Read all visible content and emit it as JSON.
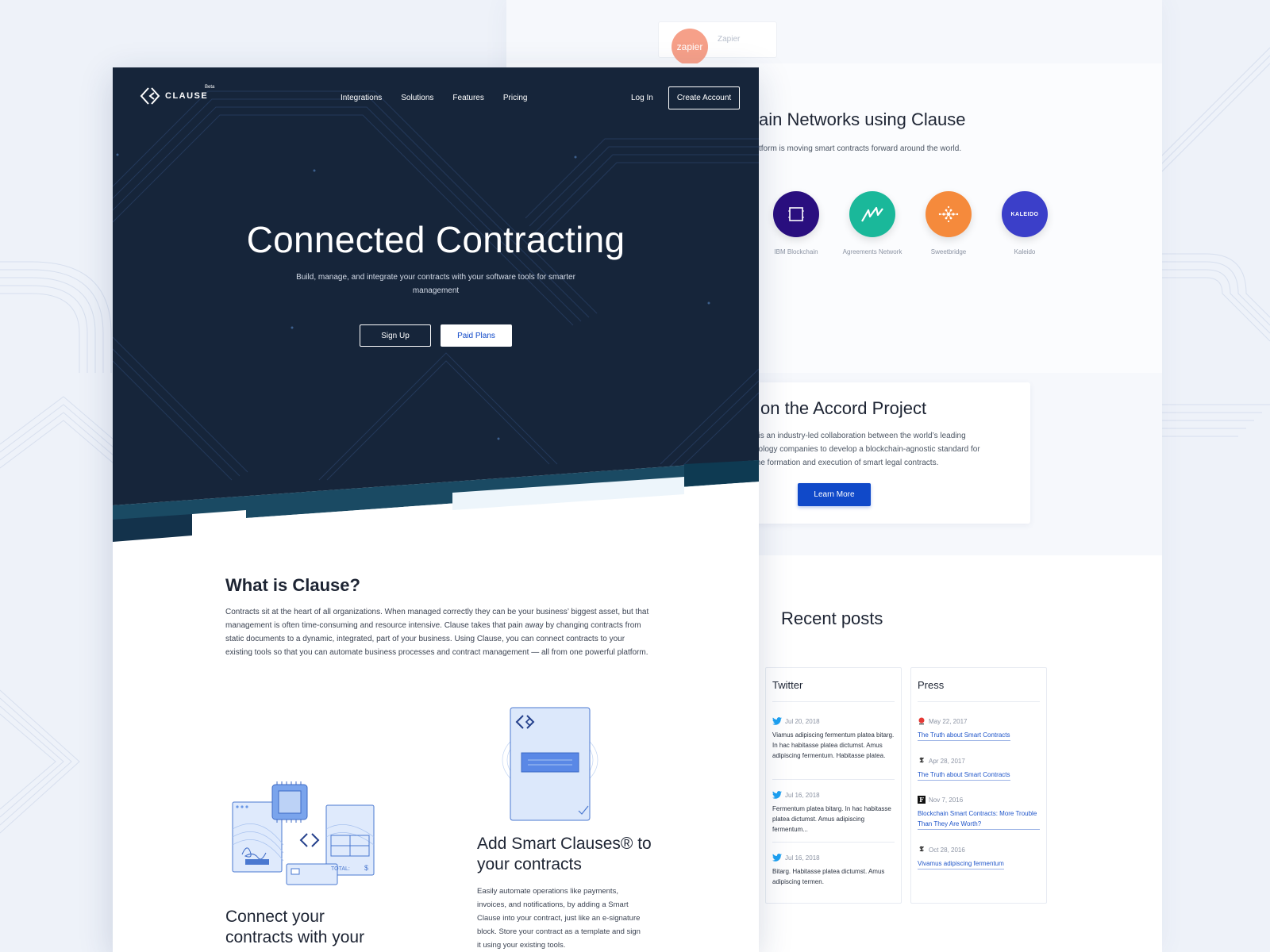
{
  "colors": {
    "hero_bg": "#16253a",
    "accent_blue": "#1049c9",
    "ibm": "#2a0f7f",
    "agreements": "#1ab89a",
    "sweetbridge": "#f58a3c",
    "kaleido": "#3b3fc9",
    "zapier": "#f6a089"
  },
  "back": {
    "zapier": {
      "logo_text": "zapier",
      "name": "Zapier"
    },
    "blockchain": {
      "title": "ain Networks using Clause",
      "subtitle": "tform is moving smart contracts forward around the world.",
      "networks": [
        {
          "icon": "square-icon",
          "label": "IBM Blockchain"
        },
        {
          "icon": "zigzag-icon",
          "label": "Agreements Network"
        },
        {
          "icon": "sweetbridge-icon",
          "label": "Sweetbridge"
        },
        {
          "icon": "kaleido-icon",
          "logo_text": "KALEIDO",
          "label": "Kaleido"
        }
      ]
    },
    "accord": {
      "title": "on the Accord Project",
      "text": "t is an industry-led collaboration between the world’s leading nology companies to develop a blockchain-agnostic standard for the formation and execution of smart legal contracts.",
      "button": "Learn More"
    },
    "posts": {
      "title": "Recent posts",
      "twitter": {
        "title": "Twitter",
        "items": [
          {
            "date": "Jul 20, 2018",
            "text": "Viamus adipiscing fermentum platea bitarg. In hac habitasse platea dictumst. Amus adipiscing fermentum. Habitasse platea."
          },
          {
            "date": "Jul 16, 2018",
            "text": "Fermentum platea bitarg. In hac habitasse platea dictumst. Amus adipiscing fermentum..."
          },
          {
            "date": "Jul 16, 2018",
            "text": "Bitarg. Habitasse platea dictumst. Amus adipiscing termen."
          }
        ]
      },
      "press": {
        "title": "Press",
        "items": [
          {
            "publisher": "red-dot-icon",
            "date": "May 22, 2017",
            "link": "The Truth about Smart Contracts"
          },
          {
            "publisher": "nyt-icon",
            "mark": "𝕿",
            "date": "Apr 28, 2017",
            "link": "The Truth about Smart Contracts"
          },
          {
            "publisher": "forbes-icon",
            "mark": "F",
            "date": "Nov 7, 2016",
            "link": "Blockchain Smart Contracts: More Trouble Than They Are Worth?"
          },
          {
            "publisher": "nyt-icon",
            "mark": "𝕿",
            "date": "Oct 28, 2016",
            "link": "Vivamus adipiscing fermentum"
          }
        ]
      }
    }
  },
  "front": {
    "logo": {
      "word": "CLAUSE",
      "beta": "Beta"
    },
    "nav": [
      "Integrations",
      "Solutions",
      "Features",
      "Pricing"
    ],
    "login": "Log In",
    "create_account": "Create Account",
    "hero": {
      "title": "Connected Contracting",
      "subtitle": "Build, manage, and integrate your contracts with your software tools for smarter management",
      "signup": "Sign Up",
      "paid_plans": "Paid Plans"
    },
    "what": {
      "title": "What is Clause?",
      "text": "Contracts sit at the heart of all organizations. When managed correctly they can be your business’ biggest asset, but that management is often time-consuming and resource intensive. Clause takes that pain away by changing contracts from static documents to a dynamic, integrated, part of your business. Using Clause, you can connect contracts to your existing tools so that you can automate business processes and contract management — all from one powerful platform."
    },
    "feature_connect": {
      "title": "Connect your contracts with your",
      "illustration_total": "TOTAL:",
      "illustration_currency": "$"
    },
    "feature_smart": {
      "title": "Add Smart Clauses® to your contracts",
      "text": "Easily automate operations like payments, invoices, and notifications, by adding a Smart Clause into your contract, just like an e-signature block. Store your contract as a template and sign it using your existing tools."
    }
  }
}
